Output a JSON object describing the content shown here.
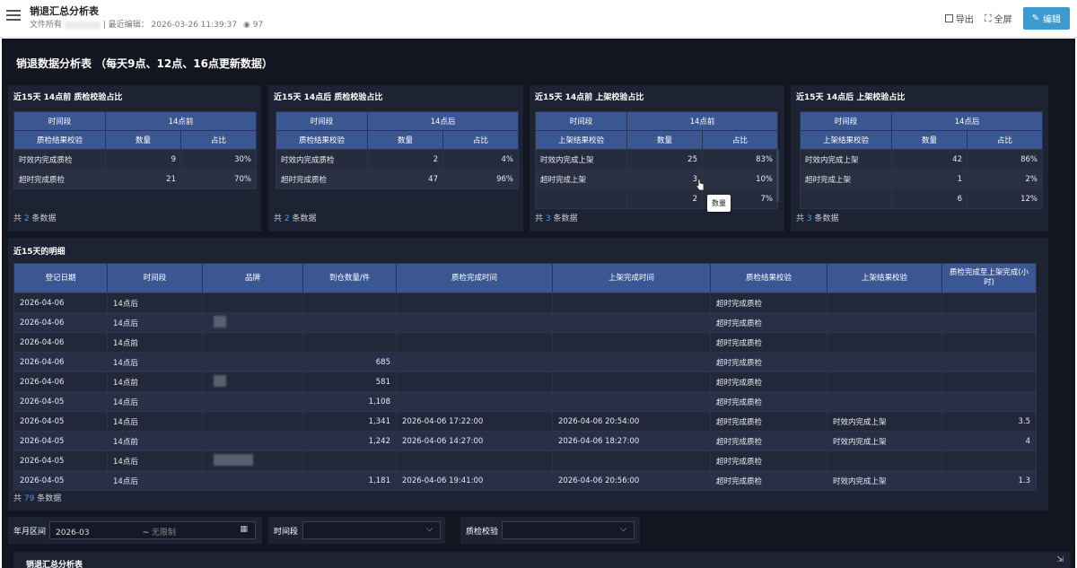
{
  "app": {
    "title": "销退汇总分析表",
    "owner_label": "文件所有",
    "meta": "| 最近编辑： 2026-03-26 11:39:37",
    "views": "97"
  },
  "toolbar": {
    "export": "导出",
    "fullscreen": "全屏",
    "edit": "编辑"
  },
  "dashboard": {
    "title": "销退数据分析表 （每天9点、12点、16点更新数据）"
  },
  "panels": [
    {
      "title": "近15天 14点前 质检校验占比",
      "period_label": "时间段",
      "period_value": "14点前",
      "headers": [
        "质检结果校验",
        "数量",
        "占比"
      ],
      "rows": [
        [
          "时效内完成质检",
          "9",
          "30%"
        ],
        [
          "超时完成质检",
          "21",
          "70%"
        ]
      ],
      "footer_pre": "共",
      "footer_num": "2",
      "footer_post": "条数据"
    },
    {
      "title": "近15天 14点后 质检校验占比",
      "period_label": "时间段",
      "period_value": "14点后",
      "headers": [
        "质检结果校验",
        "数量",
        "占比"
      ],
      "rows": [
        [
          "时效内完成质检",
          "2",
          "4%"
        ],
        [
          "超时完成质检",
          "47",
          "96%"
        ]
      ],
      "footer_pre": "共",
      "footer_num": "2",
      "footer_post": "条数据"
    },
    {
      "title": "近15天 14点前 上架校验占比",
      "period_label": "时间段",
      "period_value": "14点前",
      "headers": [
        "上架结果校验",
        "数量",
        "占比"
      ],
      "rows": [
        [
          "时效内完成上架",
          "25",
          "83%"
        ],
        [
          "超时完成上架",
          "3",
          "10%"
        ],
        [
          "",
          "2",
          "7%"
        ]
      ],
      "footer_pre": "共",
      "footer_num": "3",
      "footer_post": "条数据"
    },
    {
      "title": "近15天 14点后 上架校验占比",
      "period_label": "时间段",
      "period_value": "14点后",
      "headers": [
        "上架结果校验",
        "数量",
        "占比"
      ],
      "rows": [
        [
          "时效内完成上架",
          "42",
          "86%"
        ],
        [
          "超时完成上架",
          "1",
          "2%"
        ],
        [
          "",
          "6",
          "12%"
        ]
      ],
      "footer_pre": "共",
      "footer_num": "3",
      "footer_post": "条数据"
    }
  ],
  "tooltip": "数量",
  "detail": {
    "title": "近15天的明细",
    "headers": [
      "登记日期",
      "时间段",
      "品牌",
      "到仓数量/件",
      "质检完成时间",
      "上架完成时间",
      "质检结果校验",
      "上架结果校验",
      "质检完成至上架完成(小时)"
    ],
    "rows": [
      [
        "2026-04-06",
        "14点后",
        "",
        "",
        "",
        "",
        "超时完成质检",
        "",
        ""
      ],
      [
        "2026-04-06",
        "14点后",
        "",
        "",
        "",
        "",
        "超时完成质检",
        "",
        ""
      ],
      [
        "2026-04-06",
        "14点前",
        "",
        "",
        "",
        "",
        "超时完成质检",
        "",
        ""
      ],
      [
        "2026-04-06",
        "14点后",
        "",
        "685",
        "",
        "",
        "超时完成质检",
        "",
        ""
      ],
      [
        "2026-04-06",
        "14点前",
        "",
        "581",
        "",
        "",
        "超时完成质检",
        "",
        ""
      ],
      [
        "2026-04-05",
        "14点后",
        "",
        "1,108",
        "",
        "",
        "超时完成质检",
        "",
        ""
      ],
      [
        "2026-04-05",
        "14点后",
        "",
        "1,341",
        "2026-04-06 17:22:00",
        "2026-04-06 20:54:00",
        "超时完成质检",
        "时效内完成上架",
        "3.5"
      ],
      [
        "2026-04-05",
        "14点前",
        "",
        "1,242",
        "2026-04-06 14:27:00",
        "2026-04-06 18:27:00",
        "超时完成质检",
        "时效内完成上架",
        "4"
      ],
      [
        "2026-04-05",
        "14点后",
        "",
        "",
        "",
        "",
        "超时完成质检",
        "",
        ""
      ],
      [
        "2026-04-05",
        "14点后",
        "",
        "1,181",
        "2026-04-06 19:41:00",
        "2026-04-06 20:56:00",
        "超时完成质检",
        "时效内完成上架",
        "1.3"
      ]
    ],
    "footer_pre": "共",
    "footer_num": "79",
    "footer_post": "条数据"
  },
  "filters": {
    "month_label": "年月区间",
    "month_start": "2026-03",
    "month_sep": "~",
    "month_end": "无限制",
    "period_label": "时间段",
    "period_value": "",
    "qc_label": "质检校验",
    "qc_value": ""
  },
  "bottom": {
    "title": "销退汇总分析表"
  },
  "colors": {
    "bg": "#131620",
    "panel": "#1e2333",
    "header": "#3a5792",
    "accent": "#4a9de0",
    "edit_button": "#3b9bd1"
  }
}
